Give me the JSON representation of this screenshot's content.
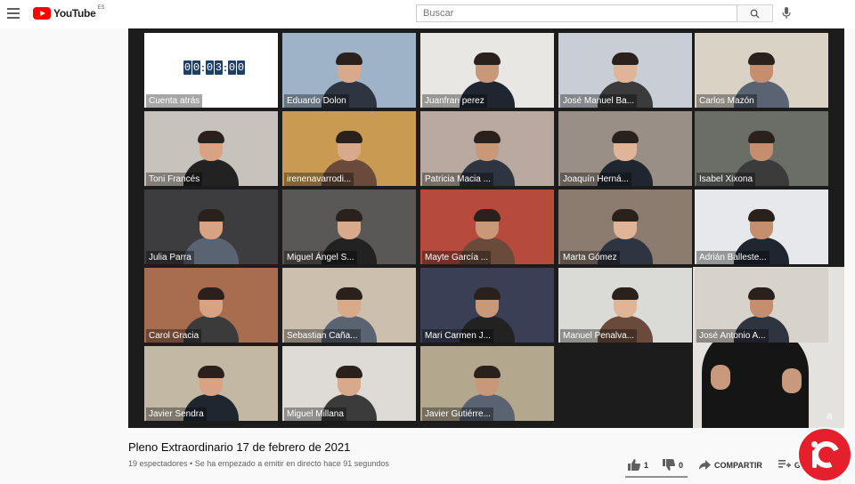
{
  "app": {
    "name": "YouTube",
    "region": "ES"
  },
  "search": {
    "placeholder": "Buscar"
  },
  "grid": {
    "countdown": {
      "digits": [
        "0",
        "0",
        ":",
        "0",
        "3",
        ":",
        "0",
        "0"
      ],
      "label": "Cuenta atrás"
    },
    "tiles": [
      {
        "label": "Eduardo Dolon",
        "bg": "#9fb3c8"
      },
      {
        "label": "Juanfran perez",
        "bg": "#e9e7e3"
      },
      {
        "label": "José Manuel Ba...",
        "bg": "#c9ced6"
      },
      {
        "label": "Carlos Mazón",
        "bg": "#d9d2c5",
        "active": true
      },
      {
        "label": "Toni Francés",
        "bg": "#c7c2bb"
      },
      {
        "label": "irenenavarrodi...",
        "bg": "#c89a52"
      },
      {
        "label": "Patricia Macia ...",
        "bg": "#b9a9a0"
      },
      {
        "label": "Joaquín Herná...",
        "bg": "#9a8f86"
      },
      {
        "label": "Isabel Xixona",
        "bg": "#6b6e66"
      },
      {
        "label": "Julia Parra",
        "bg": "#3d3d3f"
      },
      {
        "label": "Miguel Ángel S...",
        "bg": "#5a5856"
      },
      {
        "label": "Mayte García ...",
        "bg": "#b64a3c"
      },
      {
        "label": "Marta Gómez",
        "bg": "#8c7b6f"
      },
      {
        "label": "Adrián Balleste...",
        "bg": "#e6e8eb"
      },
      {
        "label": "Carol Gracia",
        "bg": "#a86d4f"
      },
      {
        "label": "Sebastian Caña...",
        "bg": "#cdbfae"
      },
      {
        "label": "Mari Carmen J...",
        "bg": "#3b3f56"
      },
      {
        "label": "Manuel Penalva...",
        "bg": "#dadad6"
      },
      {
        "label": "José Antonio A...",
        "bg": "#d7d3cb"
      },
      {
        "label": "Javier Sendra",
        "bg": "#c2b8a4"
      },
      {
        "label": "Miguel Millana",
        "bg": "#dedbd6"
      },
      {
        "label": "Javier Gutiérre...",
        "bg": "#b3a78e"
      }
    ]
  },
  "video": {
    "title": "Pleno Extraordinario 17 de febrero de 2021",
    "meta": "19 espectadores • Se ha empezado a emitir en directo hace 91 segundos",
    "likes": "1",
    "dislikes": "0",
    "share": "COMPARTIR",
    "save": "GUA"
  },
  "icons": [
    "menu-icon",
    "search-icon",
    "mic-icon",
    "thumbs-up-icon",
    "thumbs-down-icon",
    "share-icon",
    "playlist-add-icon",
    "channel-logo-icon"
  ],
  "colors": {
    "accent": "#ff0000",
    "active_speaker": "#5fc43a",
    "badge": "#e5202c"
  }
}
